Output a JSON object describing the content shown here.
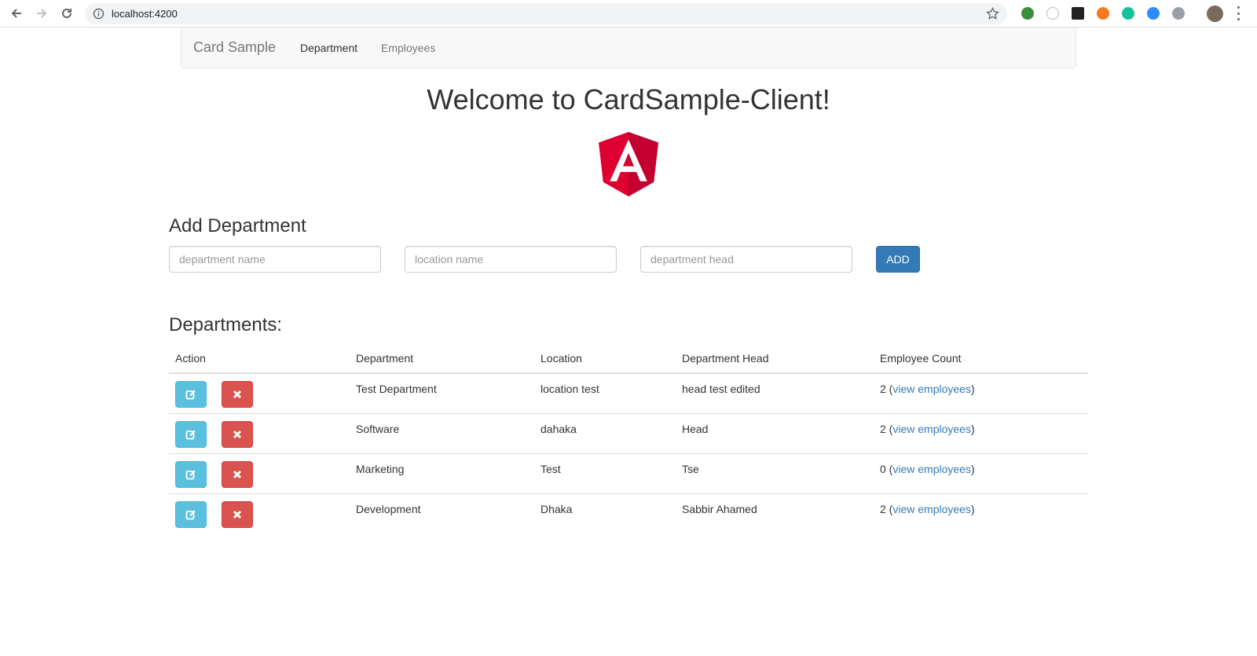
{
  "browser": {
    "url": "localhost:4200"
  },
  "navbar": {
    "brand": "Card Sample",
    "links": [
      {
        "label": "Department",
        "active": true
      },
      {
        "label": "Employees",
        "active": false
      }
    ]
  },
  "welcome_title": "Welcome to CardSample-Client!",
  "logo": {
    "icon": "angular-logo",
    "letter": "A",
    "color": "#dd0031"
  },
  "add_department": {
    "title": "Add Department",
    "fields": [
      {
        "placeholder": "department name",
        "value": ""
      },
      {
        "placeholder": "location name",
        "value": ""
      },
      {
        "placeholder": "department head",
        "value": ""
      }
    ],
    "add_label": "ADD"
  },
  "departments": {
    "title": "Departments:",
    "columns": [
      "Action",
      "Department",
      "Location",
      "Department Head",
      "Employee Count"
    ],
    "rows": [
      {
        "department": "Test Department",
        "location": "location test",
        "head": "head test edited",
        "count": "2",
        "link_label": "view employees"
      },
      {
        "department": "Software",
        "location": "dahaka",
        "head": "Head",
        "count": "2",
        "link_label": "view employees"
      },
      {
        "department": "Marketing",
        "location": "Test",
        "head": "Tse",
        "count": "0",
        "link_label": "view employees"
      },
      {
        "department": "Development",
        "location": "Dhaka",
        "head": "Sabbir Ahamed",
        "count": "2",
        "link_label": "view employees"
      }
    ]
  },
  "colors": {
    "primary": "#337ab7",
    "info": "#5bc0de",
    "danger": "#d9534f"
  }
}
